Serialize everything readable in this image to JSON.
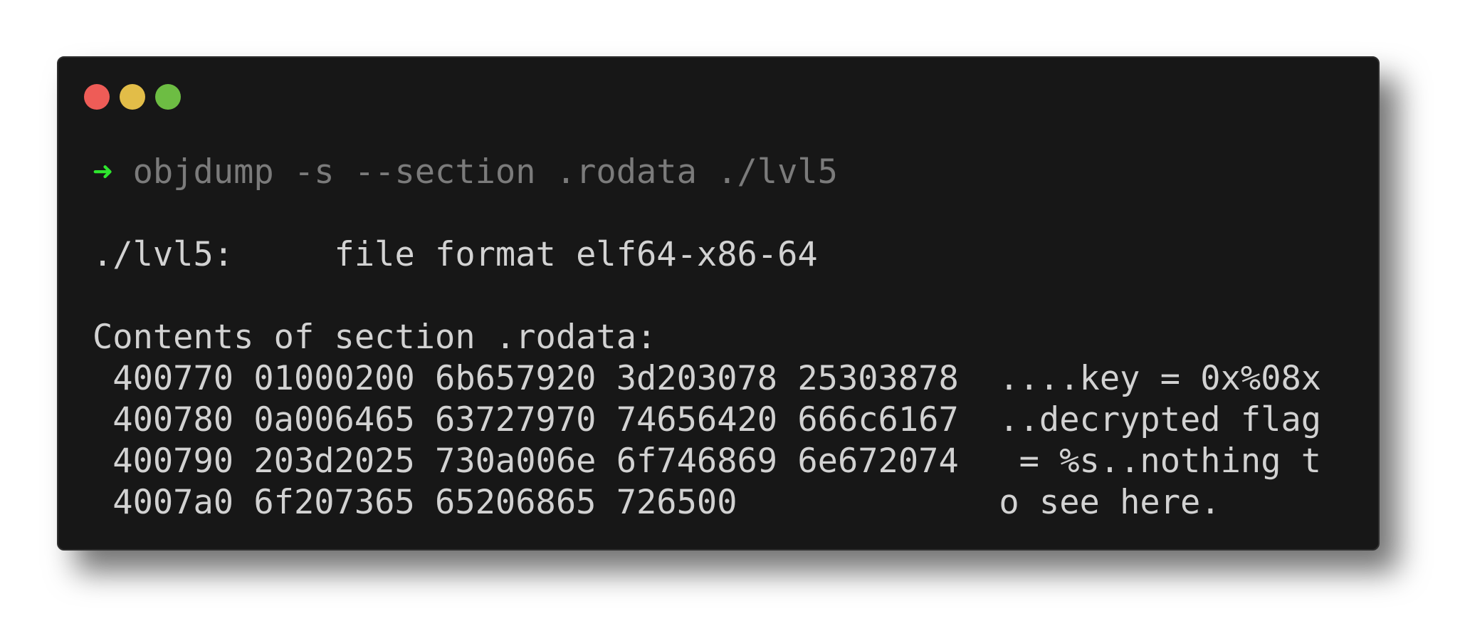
{
  "window": {
    "traffic_lights": [
      {
        "name": "close",
        "color": "#ee5c57"
      },
      {
        "name": "minimize",
        "color": "#e2bd48"
      },
      {
        "name": "zoom",
        "color": "#6dbd43"
      }
    ]
  },
  "terminal": {
    "prompt_symbol": "➜",
    "prompt_color": "#2ee62e",
    "command": "objdump -s --section .rodata ./lvl5",
    "file_line": "./lvl5:     file format elf64-x86-64",
    "section_header": "Contents of section .rodata:",
    "rows": [
      " 400770 01000200 6b657920 3d203078 25303878  ....key = 0x%08x",
      " 400780 0a006465 63727970 74656420 666c6167  ..decrypted flag",
      " 400790 203d2025 730a006e 6f746869 6e672074   = %s..nothing t",
      " 4007a0 6f207365 65206865 726500             o see here."
    ]
  }
}
